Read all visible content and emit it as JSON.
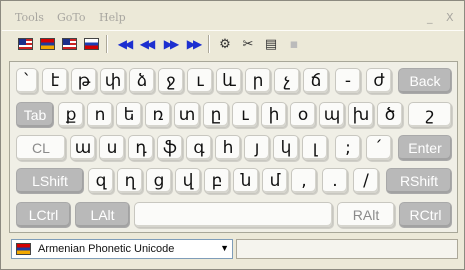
{
  "menu": {
    "tools": "Tools",
    "goto": "GoTo",
    "help": "Help",
    "minimize": "_",
    "close": "X"
  },
  "toolbar": {
    "layout_buttons": [
      {
        "flag": "us",
        "icon": "us-flag-icon"
      },
      {
        "flag": "am",
        "icon": "armenian-flag-icon"
      },
      {
        "flag": "us",
        "icon": "us-flag-icon"
      },
      {
        "flag": "ru",
        "icon": "russian-flag-icon"
      }
    ],
    "nav_buttons": [
      {
        "glyph": "◀◀",
        "icon": "first-icon"
      },
      {
        "glyph": "◀◀",
        "icon": "previous-icon"
      },
      {
        "glyph": "▶▶",
        "icon": "next-icon"
      },
      {
        "glyph": "▶▶",
        "icon": "last-icon"
      }
    ],
    "tool_buttons": [
      {
        "glyph": "⚙",
        "icon": "settings-icon"
      },
      {
        "glyph": "✂",
        "icon": "tools-icon"
      },
      {
        "glyph": "▤",
        "icon": "document-icon"
      },
      {
        "glyph": "▪",
        "icon": "blank-icon"
      }
    ]
  },
  "keyboard": {
    "row1": [
      "`",
      "է",
      "թ",
      "փ",
      "ձ",
      "ջ",
      "ւ",
      "և",
      "ր",
      "չ",
      "ճ",
      "-",
      "ժ"
    ],
    "row1_back": "Back",
    "row2_tab": "Tab",
    "row2": [
      "ք",
      "ո",
      "ե",
      "ռ",
      "տ",
      "ը",
      "ւ",
      "ի",
      "օ",
      "պ",
      "խ",
      "ծ",
      "շ"
    ],
    "row3_cl": "CL",
    "row3": [
      "ա",
      "ս",
      "դ",
      "ֆ",
      "գ",
      "հ",
      "յ",
      "կ",
      "լ",
      ";",
      "՛"
    ],
    "row3_enter": "Enter",
    "row4_lshift": "LShift",
    "row4": [
      "զ",
      "ղ",
      "ց",
      "վ",
      "բ",
      "ն",
      "մ",
      ",",
      ".",
      "/"
    ],
    "row4_rshift": "RShift",
    "row5_lctrl": "LCtrl",
    "row5_lalt": "LAlt",
    "row5_space": "",
    "row5_ralt": "RAlt",
    "row5_rctrl": "RCtrl"
  },
  "status": {
    "layout_name": "Armenian Phonetic Unicode",
    "layout_flag": "am",
    "dropdown_arrow": "▼",
    "field_value": ""
  }
}
